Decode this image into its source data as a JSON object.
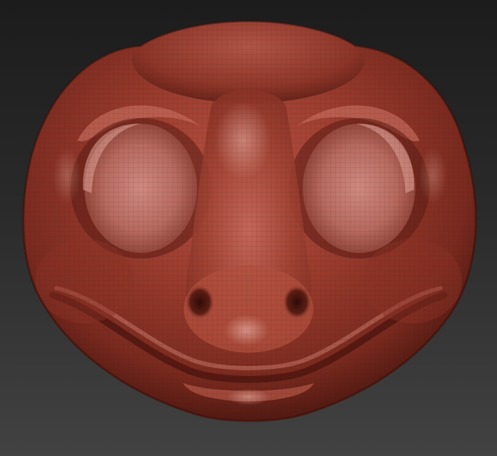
{
  "viewport": {
    "background_top": "#1c1c1c",
    "background_bottom": "#424242"
  },
  "model": {
    "subject": "sculpted-reptile-head",
    "material_base": "#9a3c2e",
    "material_highlight": "#d89a8e",
    "material_shadow": "#4a1710",
    "wireframe_visible": true
  }
}
